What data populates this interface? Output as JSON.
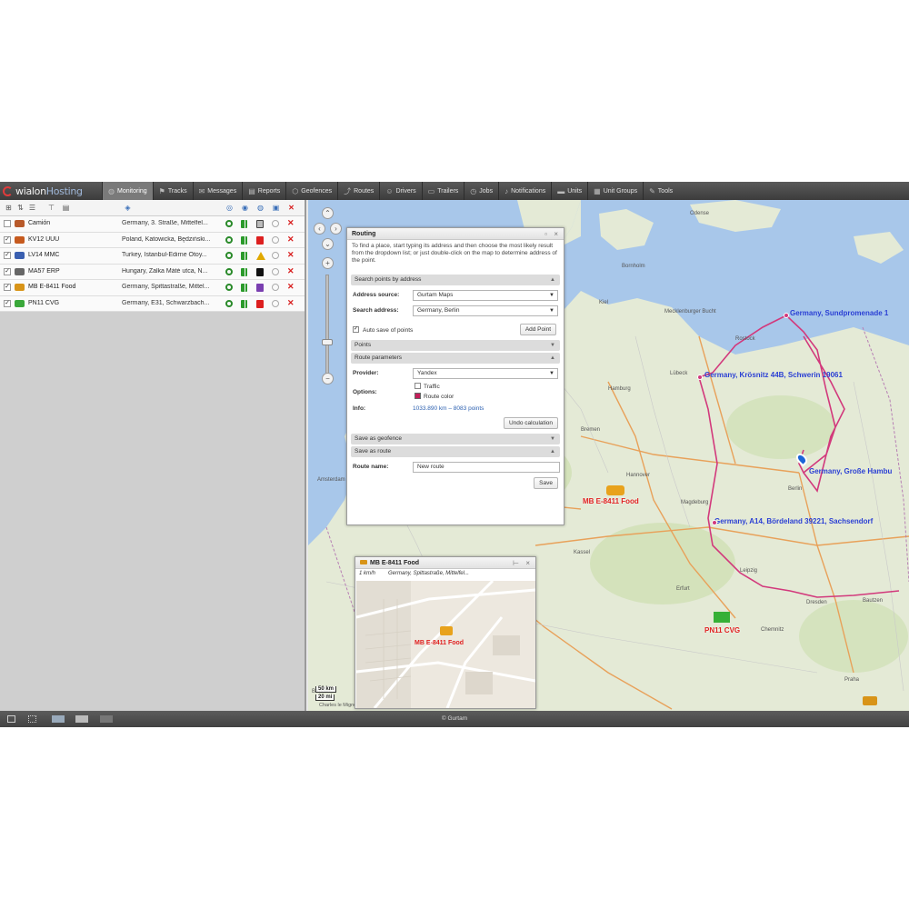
{
  "app": {
    "logo_main": "wialon",
    "logo_sub": "Hosting"
  },
  "nav": [
    {
      "label": "Monitoring",
      "icon": "globe-icon",
      "active": true
    },
    {
      "label": "Tracks",
      "icon": "flag-icon"
    },
    {
      "label": "Messages",
      "icon": "envelope-icon"
    },
    {
      "label": "Reports",
      "icon": "report-icon"
    },
    {
      "label": "Geofences",
      "icon": "geofence-icon"
    },
    {
      "label": "Routes",
      "icon": "route-icon"
    },
    {
      "label": "Drivers",
      "icon": "driver-icon"
    },
    {
      "label": "Trailers",
      "icon": "trailer-icon"
    },
    {
      "label": "Jobs",
      "icon": "clock-icon"
    },
    {
      "label": "Notifications",
      "icon": "bell-icon"
    },
    {
      "label": "Units",
      "icon": "truck-icon"
    },
    {
      "label": "Unit Groups",
      "icon": "group-icon"
    },
    {
      "label": "Tools",
      "icon": "tools-icon"
    }
  ],
  "units": [
    {
      "name": "Camión",
      "address": "Germany, 3. Straße, Mittelfel...",
      "checked": false,
      "color": "#b85a2a",
      "st_b": "#2a9a2a",
      "st_c": "#777777",
      "st_c_shape": "box"
    },
    {
      "name": "KV12 UUU",
      "address": "Poland, Katowicka, Będziński...",
      "checked": true,
      "color": "#c65a1e",
      "st_b": "#2a9a2a",
      "st_c": "#dd1f1f",
      "st_c_shape": "bar"
    },
    {
      "name": "LV14 MMC",
      "address": "Turkey, İstanbul-Edirne Otoy...",
      "checked": true,
      "color": "#3a5fb0",
      "st_b": "#2a9a2a",
      "st_c": "#e0a800",
      "st_c_shape": "warn"
    },
    {
      "name": "MA57 ERP",
      "address": "Hungary, Zalka Máté utca, N...",
      "checked": true,
      "color": "#666666",
      "st_b": "#2a9a2a",
      "st_c": "#111111",
      "st_c_shape": "bar"
    },
    {
      "name": "MB E-8411 Food",
      "address": "Germany, Spittastraße, Mittel...",
      "checked": true,
      "color": "#d89418",
      "st_b": "#2a9a2a",
      "st_c": "#7a3fb0",
      "st_c_shape": "bar"
    },
    {
      "name": "PN11 CVG",
      "address": "Germany, E31, Schwarzbach...",
      "checked": true,
      "color": "#3aa83a",
      "st_b": "#2a9a2a",
      "st_c": "#dd1f1f",
      "st_c_shape": "bar"
    }
  ],
  "map": {
    "labels": [
      {
        "text": "Germany, Sundpromenade 1",
        "color": "#2a3fd4"
      },
      {
        "text": "Germany, Krösnitz 44B, Schwerin 19061",
        "color": "#2a3fd4"
      },
      {
        "text": "Germany, Große Hambu",
        "color": "#2a3fd4"
      },
      {
        "text": "Germany, A14, Bördeland 39221, Sachsendorf",
        "color": "#2a3fd4"
      },
      {
        "text": "MB E-8411 Food",
        "color": "#e02020"
      },
      {
        "text": "PN11 CVG",
        "color": "#e02020"
      }
    ],
    "cities": [
      "Bornholm",
      "Odense",
      "Mecklenburger Bucht",
      "Kiel",
      "Hamburg",
      "Bremen",
      "Hannover",
      "Magdeburg",
      "Berlin",
      "Leipzig",
      "Dresden",
      "Kassel",
      "Chemnitz",
      "Erfurt",
      "Brussel",
      "Praha",
      "Köln",
      "Bautzen",
      "Lübeck",
      "Rostock",
      "Amsterdam"
    ],
    "scale_km": "50 km",
    "scale_mi": "20 mi",
    "attribution": "Charles le Mignon"
  },
  "routing": {
    "title": "Routing",
    "help": "To find a place, start typing its address and then choose the most likely result from the dropdown list; or just double-click on the map to determine address of the point.",
    "sec_search": "Search points by address",
    "address_source_label": "Address source:",
    "address_source_value": "Gurtam Maps",
    "search_address_label": "Search address:",
    "search_address_value": "Germany, Berlin",
    "auto_save_label": "Auto save of points",
    "add_point": "Add Point",
    "sec_points": "Points",
    "sec_route_params": "Route parameters",
    "provider_label": "Provider:",
    "provider_value": "Yandex",
    "options_label": "Options:",
    "traffic_label": "Traffic",
    "route_color_label": "Route color",
    "route_color": "#c41e5a",
    "info_label": "Info:",
    "info_value": "1033.890 km – 8083 points",
    "undo_calc": "Undo calculation",
    "sec_save_geofence": "Save as geofence",
    "sec_save_route": "Save as route",
    "route_name_label": "Route name:",
    "route_name_value": "New route",
    "save_label": "Save"
  },
  "popup": {
    "title": "MB E-8411 Food",
    "speed": "1 km/h",
    "address": "Germany, Spittastraße, Mittelfel...",
    "map_label": "MB E-8411 Food"
  },
  "status": {
    "copyright": "© Gurtam"
  }
}
